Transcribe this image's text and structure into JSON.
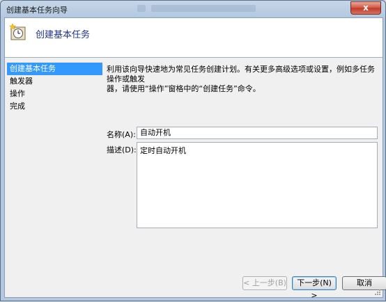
{
  "window": {
    "title": "创建基本任务向导",
    "close_label": "x"
  },
  "header": {
    "title": "创建基本任务",
    "icon": "task-scheduler-clock-icon"
  },
  "steps": [
    {
      "label": "创建基本任务",
      "active": true
    },
    {
      "label": "触发器",
      "active": false
    },
    {
      "label": "操作",
      "active": false
    },
    {
      "label": "完成",
      "active": false
    }
  ],
  "content": {
    "description_line1": "利用该向导快速地为常见任务创建计划。有关更多高级选项或设置，例如多任务操作或触发",
    "description_line2": "器，请使用“操作”窗格中的“创建任务”命令。",
    "name_label": "名称(A):",
    "name_value": "自动开机",
    "desc_label": "描述(D):",
    "desc_value": "定时自动开机"
  },
  "footer": {
    "back_label": "< 上一步(B)",
    "next_label": "下一步(N) >",
    "cancel_label": "取消"
  },
  "colors": {
    "selection": "#3399ff",
    "header_title": "#1e3287",
    "close_red": "#c0392b"
  }
}
